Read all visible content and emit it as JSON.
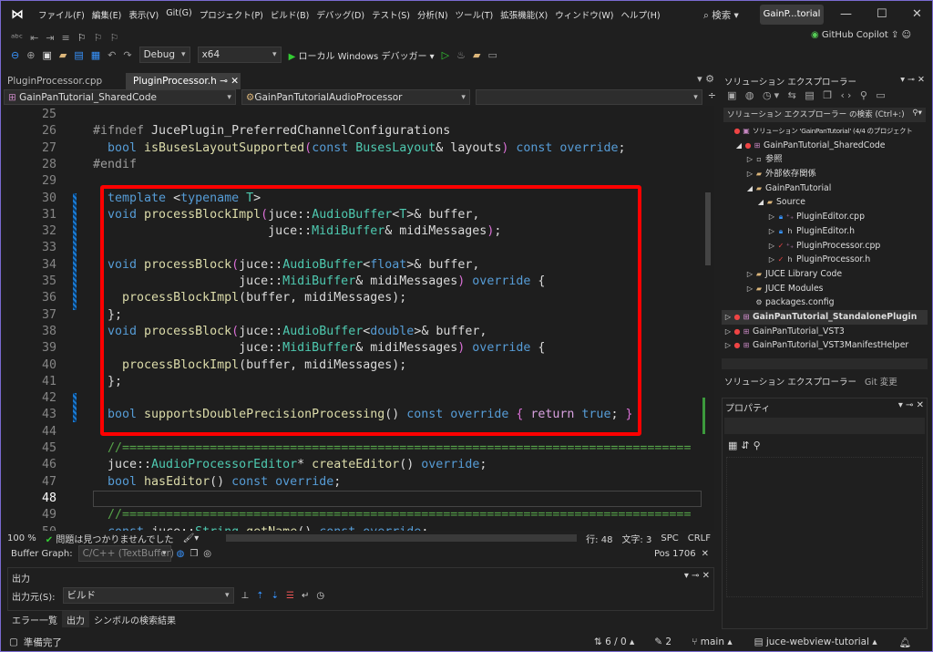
{
  "window": {
    "menu": [
      "ファイル(F)",
      "編集(E)",
      "表示(V)",
      "Git(G)",
      "プロジェクト(P)",
      "ビルド(B)",
      "デバッグ(D)",
      "テスト(S)",
      "分析(N)",
      "ツール(T)",
      "拡張機能(X)",
      "ウィンドウ(W)",
      "ヘルプ(H)"
    ],
    "search": "検索",
    "solution_short": "GainP...torial",
    "copilot": "GitHub Copilot"
  },
  "toolbar": {
    "config": "Debug",
    "platform": "x64",
    "debugger": "ローカル Windows デバッガー"
  },
  "tabs": [
    {
      "label": "PluginProcessor.cpp"
    },
    {
      "label": "PluginProcessor.h"
    }
  ],
  "nav": {
    "project": "GainPanTutorial_SharedCode",
    "scope": "GainPanTutorialAudioProcessor"
  },
  "editor": {
    "first_line": 25,
    "current_line": 48,
    "lines": [
      [],
      [
        [
          "p",
          "#ifndef "
        ],
        [
          "x",
          "JucePlugin_PreferredChannelConfigurations"
        ]
      ],
      [
        [
          "x",
          "  "
        ],
        [
          "k",
          "bool "
        ],
        [
          "f",
          "isBusesLayoutSupported"
        ],
        [
          "b",
          "("
        ],
        [
          "k",
          "const "
        ],
        [
          "t",
          "BusesLayout"
        ],
        [
          "x",
          "& layouts"
        ],
        [
          "b",
          ")"
        ],
        [
          "k",
          " const override"
        ],
        [
          "x",
          ";"
        ]
      ],
      [
        [
          "p",
          "#endif"
        ]
      ],
      [],
      [
        [
          "x",
          "  "
        ],
        [
          "k",
          "template "
        ],
        [
          "x",
          "<"
        ],
        [
          "k",
          "typename "
        ],
        [
          "t",
          "T"
        ],
        [
          "x",
          ">"
        ]
      ],
      [
        [
          "x",
          "  "
        ],
        [
          "k",
          "void "
        ],
        [
          "f",
          "processBlockImpl"
        ],
        [
          "b",
          "("
        ],
        [
          "x",
          "juce::"
        ],
        [
          "t",
          "AudioBuffer"
        ],
        [
          "x",
          "<"
        ],
        [
          "t",
          "T"
        ],
        [
          "x",
          ">& buffer,"
        ]
      ],
      [
        [
          "x",
          "                        juce::"
        ],
        [
          "t",
          "MidiBuffer"
        ],
        [
          "x",
          "& midiMessages"
        ],
        [
          "b",
          ")"
        ],
        [
          "x",
          ";"
        ]
      ],
      [],
      [
        [
          "x",
          "  "
        ],
        [
          "k",
          "void "
        ],
        [
          "f",
          "processBlock"
        ],
        [
          "b",
          "("
        ],
        [
          "x",
          "juce::"
        ],
        [
          "t",
          "AudioBuffer"
        ],
        [
          "x",
          "<"
        ],
        [
          "k",
          "float"
        ],
        [
          "x",
          ">& buffer,"
        ]
      ],
      [
        [
          "x",
          "                    juce::"
        ],
        [
          "t",
          "MidiBuffer"
        ],
        [
          "x",
          "& midiMessages"
        ],
        [
          "b",
          ")"
        ],
        [
          "k",
          " override "
        ],
        [
          "x",
          "{"
        ]
      ],
      [
        [
          "x",
          "    "
        ],
        [
          "f",
          "processBlockImpl"
        ],
        [
          "x",
          "(buffer, midiMessages);"
        ]
      ],
      [
        [
          "x",
          "  };"
        ]
      ],
      [
        [
          "x",
          "  "
        ],
        [
          "k",
          "void "
        ],
        [
          "f",
          "processBlock"
        ],
        [
          "b",
          "("
        ],
        [
          "x",
          "juce::"
        ],
        [
          "t",
          "AudioBuffer"
        ],
        [
          "x",
          "<"
        ],
        [
          "k",
          "double"
        ],
        [
          "x",
          ">& buffer,"
        ]
      ],
      [
        [
          "x",
          "                    juce::"
        ],
        [
          "t",
          "MidiBuffer"
        ],
        [
          "x",
          "& midiMessages"
        ],
        [
          "b",
          ")"
        ],
        [
          "k",
          " override "
        ],
        [
          "x",
          "{"
        ]
      ],
      [
        [
          "x",
          "    "
        ],
        [
          "f",
          "processBlockImpl"
        ],
        [
          "x",
          "(buffer, midiMessages);"
        ]
      ],
      [
        [
          "x",
          "  };"
        ]
      ],
      [],
      [
        [
          "x",
          "  "
        ],
        [
          "k",
          "bool "
        ],
        [
          "f",
          "supportsDoublePrecisionProcessing"
        ],
        [
          "x",
          "() "
        ],
        [
          "k",
          "const override "
        ],
        [
          "b",
          "{ "
        ],
        [
          "r",
          "return "
        ],
        [
          "k",
          "true"
        ],
        [
          "x",
          "; "
        ],
        [
          "b",
          "}"
        ]
      ],
      [],
      [
        [
          "x",
          "  "
        ],
        [
          "c",
          "//=============================================================================="
        ]
      ],
      [
        [
          "x",
          "  juce::"
        ],
        [
          "t",
          "AudioProcessorEditor"
        ],
        [
          "x",
          "* "
        ],
        [
          "f",
          "createEditor"
        ],
        [
          "x",
          "() "
        ],
        [
          "k",
          "override"
        ],
        [
          "x",
          ";"
        ]
      ],
      [
        [
          "x",
          "  "
        ],
        [
          "k",
          "bool "
        ],
        [
          "f",
          "hasEditor"
        ],
        [
          "x",
          "() "
        ],
        [
          "k",
          "const override"
        ],
        [
          "x",
          ";"
        ]
      ],
      [],
      [
        [
          "x",
          "  "
        ],
        [
          "c",
          "//=============================================================================="
        ]
      ],
      [
        [
          "x",
          "  "
        ],
        [
          "k",
          "const "
        ],
        [
          "x",
          "juce::"
        ],
        [
          "t",
          "String "
        ],
        [
          "f",
          "getName"
        ],
        [
          "x",
          "() "
        ],
        [
          "k",
          "const override"
        ],
        [
          "x",
          ";"
        ]
      ]
    ]
  },
  "editor_status": {
    "zoom": "100 %",
    "issues": "問題は見つかりませんでした",
    "line": "行: 48",
    "char": "文字: 3",
    "spc": "SPC",
    "crlf": "CRLF"
  },
  "buffer_graph": {
    "label": "Buffer Graph:",
    "value": "C/C++ (TextBuffer)",
    "pos": "Pos 1706"
  },
  "output": {
    "title": "出力",
    "source_label": "出力元(S):",
    "source": "ビルド"
  },
  "bottom_tabs": [
    "エラー一覧",
    "出力",
    "シンボルの検索結果"
  ],
  "statusbar": {
    "ready": "準備完了",
    "sync": "6 / 0",
    "edits": "2",
    "branch": "main",
    "repo": "juce-webview-tutorial"
  },
  "solution_explorer": {
    "title": "ソリューション エクスプローラー",
    "search": "ソリューション エクスプローラー の検索 (Ctrl+:)",
    "tabs": [
      "ソリューション エクスプローラー",
      "Git 変更"
    ],
    "items": [
      {
        "label": "ソリューション 'GainPanTutorial' (4/4 のプロジェクト",
        "level": 0,
        "icon": "solution-icon"
      },
      {
        "label": "GainPanTutorial_SharedCode",
        "level": 1,
        "icon": "project-icon",
        "expanded": true
      },
      {
        "label": "参照",
        "level": 2,
        "icon": "references-icon"
      },
      {
        "label": "外部依存関係",
        "level": 2,
        "icon": "folder-icon"
      },
      {
        "label": "GainPanTutorial",
        "level": 2,
        "icon": "filter-folder-icon",
        "expanded": true
      },
      {
        "label": "Source",
        "level": 3,
        "icon": "filter-folder-icon",
        "expanded": true
      },
      {
        "label": "PluginEditor.cpp",
        "level": 4,
        "icon": "cpp-file-icon",
        "status": "lock"
      },
      {
        "label": "PluginEditor.h",
        "level": 4,
        "icon": "header-file-icon",
        "status": "lock"
      },
      {
        "label": "PluginProcessor.cpp",
        "level": 4,
        "icon": "cpp-file-icon",
        "status": "check"
      },
      {
        "label": "PluginProcessor.h",
        "level": 4,
        "icon": "header-file-icon",
        "status": "check"
      },
      {
        "label": "JUCE Library Code",
        "level": 2,
        "icon": "filter-folder-icon"
      },
      {
        "label": "JUCE Modules",
        "level": 2,
        "icon": "filter-folder-icon"
      },
      {
        "label": "packages.config",
        "level": 2,
        "icon": "config-file-icon"
      },
      {
        "label": "GainPanTutorial_StandalonePlugin",
        "level": 0,
        "icon": "project-icon",
        "bold": true
      },
      {
        "label": "GainPanTutorial_VST3",
        "level": 0,
        "icon": "project-icon"
      },
      {
        "label": "GainPanTutorial_VST3ManifestHelper",
        "level": 0,
        "icon": "project-icon"
      }
    ]
  },
  "properties": {
    "title": "プロパティ"
  },
  "colors": {
    "highlight_box": "#ff0000",
    "keyword": "#569cd6",
    "type": "#4ec9b0",
    "function": "#dcdcaa",
    "comment": "#57a64a",
    "accent": "#7a6ad0"
  }
}
